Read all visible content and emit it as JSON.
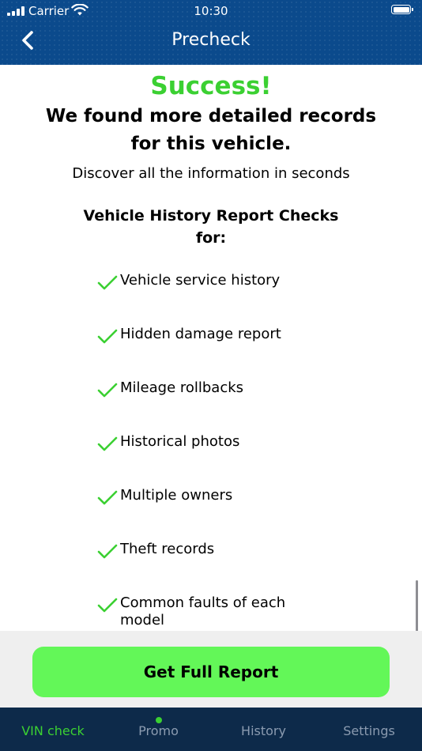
{
  "status_bar": {
    "carrier": "Carrier",
    "time": "10:30"
  },
  "nav": {
    "title": "Precheck",
    "back_icon": "chevron-left-icon"
  },
  "content": {
    "success_title": "Success!",
    "heading": "We found more detailed records for this vehicle.",
    "subtext": "Discover all the information in seconds",
    "section_title": "Vehicle History Report Checks for:",
    "checklist": [
      "Vehicle service history",
      "Hidden damage report",
      "Mileage rollbacks",
      "Historical photos",
      "Multiple owners",
      "Theft records",
      "Common faults of each model"
    ]
  },
  "action": {
    "button_label": "Get Full Report"
  },
  "tabs": [
    {
      "label": "VIN check",
      "active": true,
      "badge": false
    },
    {
      "label": "Promo",
      "active": false,
      "badge": true
    },
    {
      "label": "History",
      "active": false,
      "badge": false
    },
    {
      "label": "Settings",
      "active": false,
      "badge": false
    }
  ],
  "colors": {
    "header_blue": "#0b4a8c",
    "accent_green": "#3bd032",
    "button_green": "#63f758",
    "tab_bar": "#0d2a4a",
    "tab_inactive": "#8b9bb0"
  }
}
